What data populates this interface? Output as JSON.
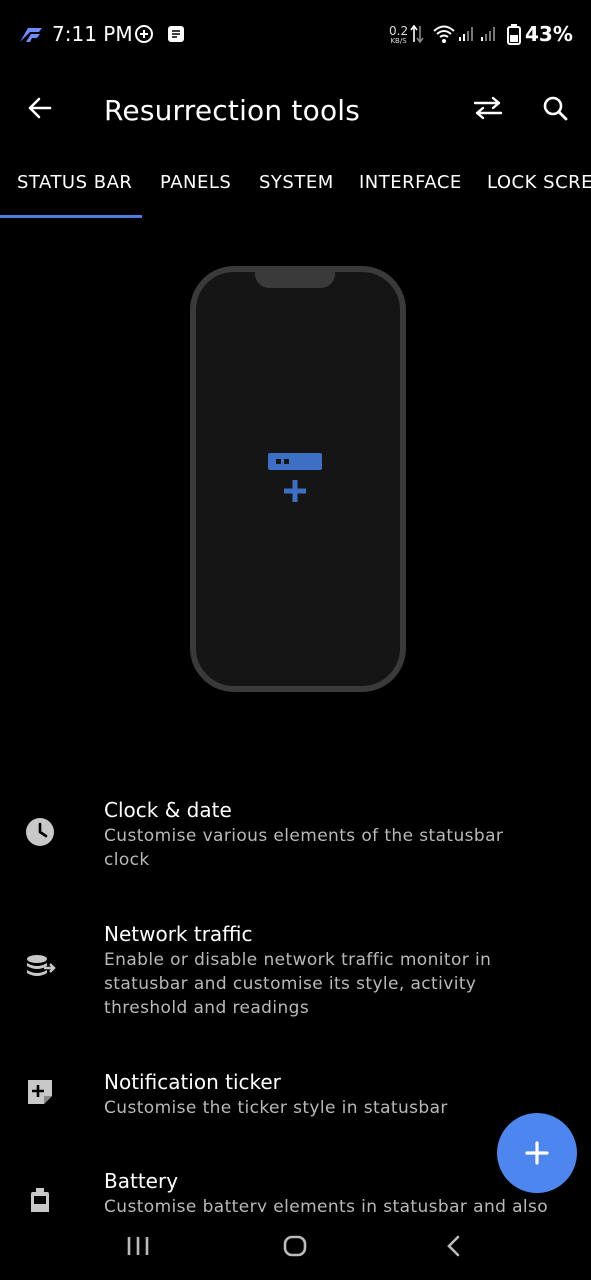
{
  "status_bar": {
    "time": "7:11 PM",
    "network_speed_value": "0.2",
    "network_speed_unit": "KB/S",
    "battery_percent": "43%",
    "icons": [
      "app-logo-icon",
      "chat-bubble-icon",
      "note-icon",
      "upload-download-icon",
      "wifi-icon",
      "signal-icon",
      "signal-icon",
      "battery-icon"
    ]
  },
  "app_bar": {
    "title": "Resurrection tools",
    "icons": [
      "back-arrow-icon",
      "swap-icon",
      "search-icon"
    ]
  },
  "tabs": [
    {
      "label": "STATUS BAR",
      "selected": true
    },
    {
      "label": "PANELS",
      "selected": false
    },
    {
      "label": "SYSTEM",
      "selected": false
    },
    {
      "label": "INTERFACE",
      "selected": false
    },
    {
      "label": "LOCK SCREEN",
      "selected": false
    }
  ],
  "illustration": {
    "icon": "statusbar-add-icon",
    "accent": "#3d6fc4"
  },
  "settings": [
    {
      "icon": "clock-icon",
      "title": "Clock & date",
      "subtitle": "Customise various elements of the statusbar clock"
    },
    {
      "icon": "network-traffic-icon",
      "title": "Network traffic",
      "subtitle": "Enable or disable network traffic monitor in statusbar and customise its style, activity threshold and readings"
    },
    {
      "icon": "ticker-icon",
      "title": "Notification ticker",
      "subtitle": "Customise the ticker style in statusbar"
    },
    {
      "icon": "battery-icon",
      "title": "Battery",
      "subtitle": "Customise battery elements in statusbar and also"
    }
  ],
  "fab": {
    "icon": "plus-icon",
    "color": "#4d86ee"
  },
  "nav_bar": {
    "icons": [
      "recents-icon",
      "home-icon",
      "back-icon"
    ]
  },
  "colors": {
    "accent": "#4a7fe0",
    "background": "#000000",
    "secondary_text": "#b9b9b9"
  }
}
